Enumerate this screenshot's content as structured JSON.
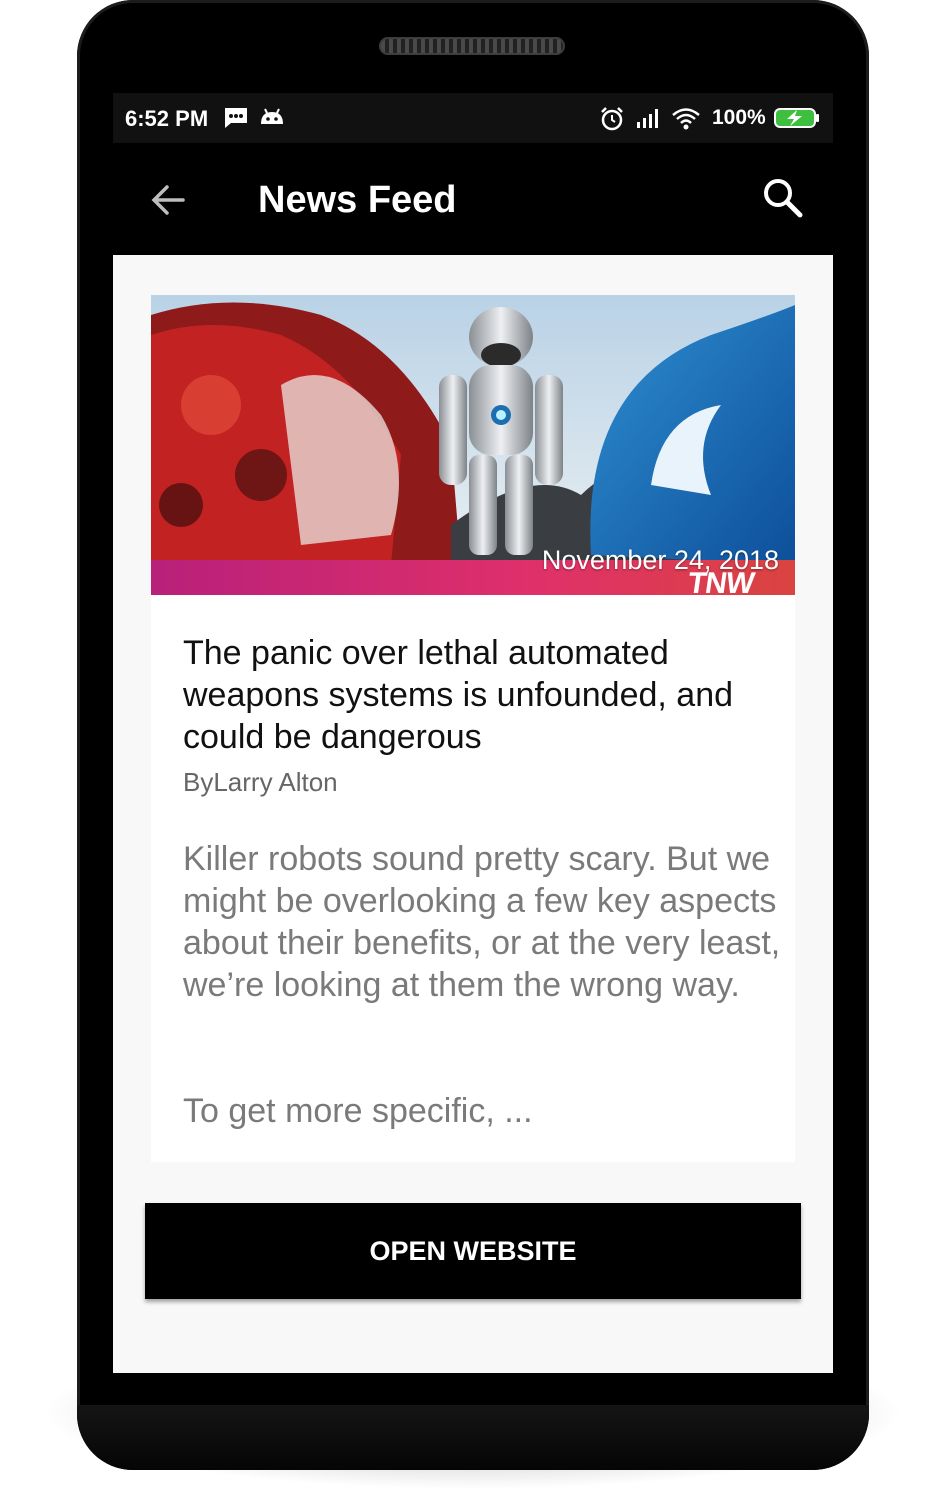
{
  "status_bar": {
    "time": "6:52 PM",
    "battery_percent": "100%",
    "icons": [
      "message-icon",
      "android-icon",
      "alarm-icon",
      "signal-icon",
      "wifi-icon",
      "battery-charging-icon"
    ]
  },
  "app_bar": {
    "title": "News Feed",
    "back_icon": "arrow-back-icon",
    "search_icon": "search-icon"
  },
  "article": {
    "image_date": "November 24, 2018",
    "image_logo": "TNW",
    "title": "The panic over lethal automated weapons systems is unfounded, and could be dangerous",
    "author": "ByLarry Alton",
    "summary": "Killer robots sound pretty scary. But we might be overlooking a few key aspects about their benefits, or at the very least, we’re looking at them the wrong way.",
    "summary_more": "To get more specific, ..."
  },
  "actions": {
    "open_website_label": "OPEN WEBSITE"
  },
  "colors": {
    "app_bar": "#000000",
    "status_bar": "#111111",
    "screen_bg": "#f8f8f8",
    "body_text": "#7a7a7a"
  }
}
